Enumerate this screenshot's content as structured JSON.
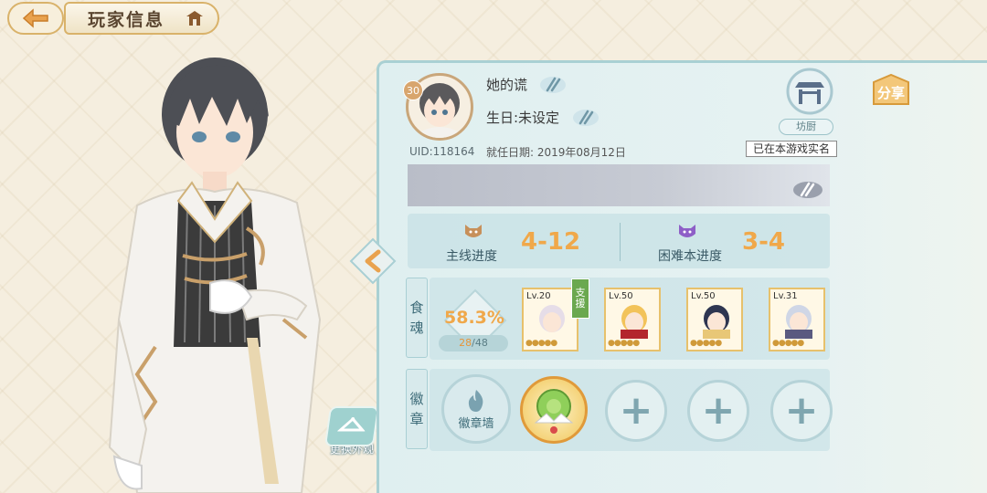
{
  "header": {
    "title": "玩家信息"
  },
  "profile": {
    "level": "30",
    "uid": "UID:118164",
    "nickname": "她的谎",
    "birthday": "生日:未设定",
    "start_date": "就任日期: 2019年08月12日",
    "role_tag": "坊厨",
    "realname_text": "已在本游戏实名"
  },
  "share": {
    "label": "分享"
  },
  "progress": {
    "main": {
      "label": "主线进度",
      "value": "4-12"
    },
    "hard": {
      "label": "困难本进度",
      "value": "3-4"
    }
  },
  "souls": {
    "section_label_1": "食",
    "section_label_2": "魂",
    "rate": "58.3%",
    "count_current": "28",
    "count_total": "/48",
    "support_tag_1": "支",
    "support_tag_2": "援",
    "cards": [
      {
        "level": "Lv.20"
      },
      {
        "level": "Lv.50"
      },
      {
        "level": "Lv.50"
      },
      {
        "level": "Lv.31"
      }
    ]
  },
  "badges": {
    "section_label_1": "徽",
    "section_label_2": "章",
    "wall_label": "徽章墙",
    "plus": "+"
  },
  "outfit": {
    "label": "更换外观"
  },
  "colors": {
    "accent_orange": "#f0a84a",
    "panel_teal": "#a9d0d3",
    "gold": "#d9b26a"
  },
  "icons": [
    "back-arrow-icon",
    "home-icon",
    "edit-icon",
    "share-icon",
    "plus-icon",
    "flame-icon",
    "bell-icon"
  ]
}
